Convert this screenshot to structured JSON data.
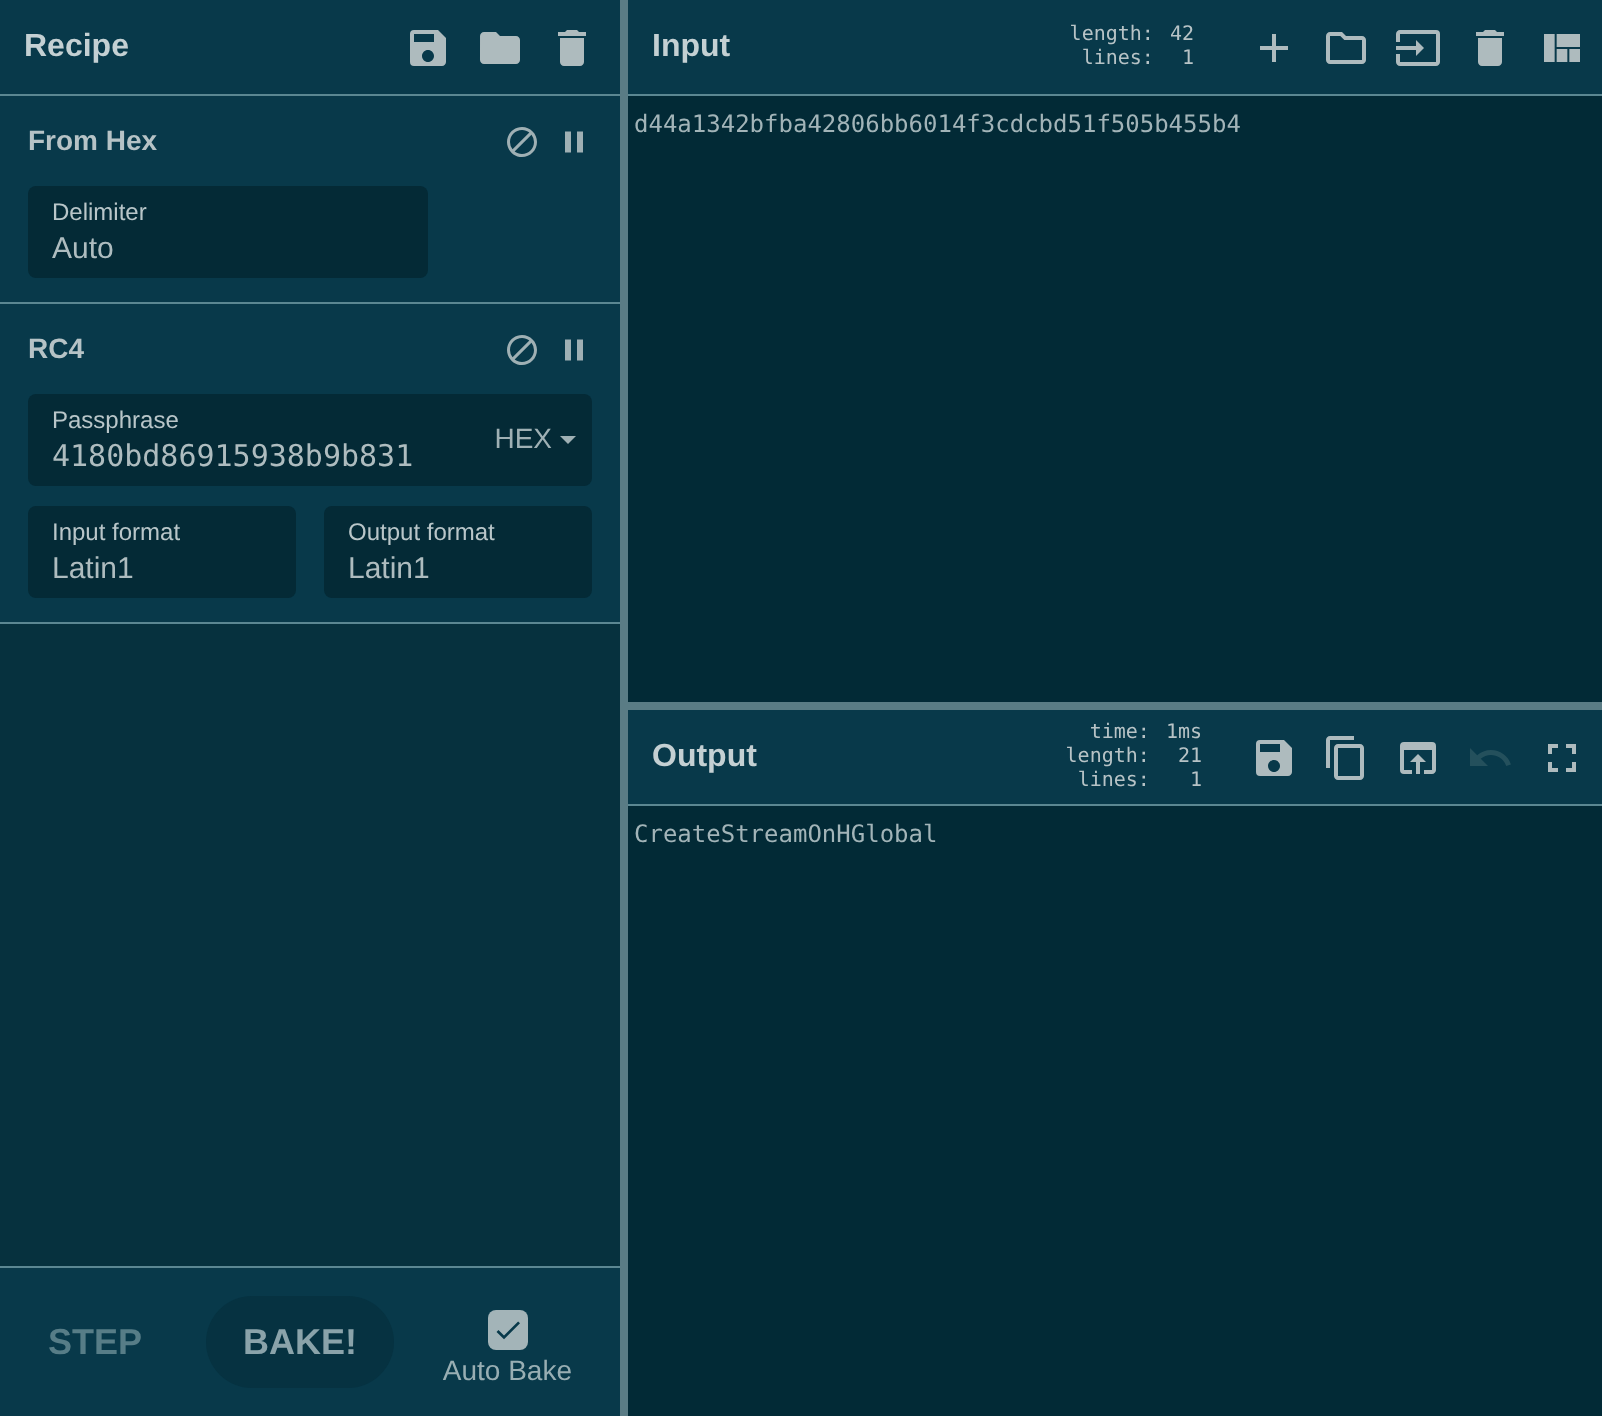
{
  "recipe": {
    "title": "Recipe",
    "operations": [
      {
        "name": "From Hex",
        "args": [
          {
            "kind": "field",
            "label": "Delimiter",
            "value": "Auto"
          }
        ]
      },
      {
        "name": "RC4",
        "args": [
          {
            "kind": "dropdown-field",
            "label": "Passphrase",
            "value": "4180bd86915938b9b831",
            "option": "HEX"
          },
          {
            "kind": "field",
            "label": "Input format",
            "value": "Latin1"
          },
          {
            "kind": "field",
            "label": "Output format",
            "value": "Latin1"
          }
        ]
      }
    ],
    "step": "STEP",
    "bake": "BAKE!",
    "auto_bake": {
      "label": "Auto Bake",
      "checked": true
    }
  },
  "input": {
    "title": "Input",
    "stats": [
      {
        "label": "length:",
        "value": "42"
      },
      {
        "label": "lines:",
        "value": "1"
      }
    ],
    "text": "d44a1342bfba42806bb6014f3cdcbd51f505b455b4"
  },
  "output": {
    "title": "Output",
    "stats": [
      {
        "label": "time:",
        "value": "1ms"
      },
      {
        "label": "length:",
        "value": "21"
      },
      {
        "label": "lines:",
        "value": "1"
      }
    ],
    "text": "CreateStreamOnHGlobal",
    "undo_disabled": true
  }
}
